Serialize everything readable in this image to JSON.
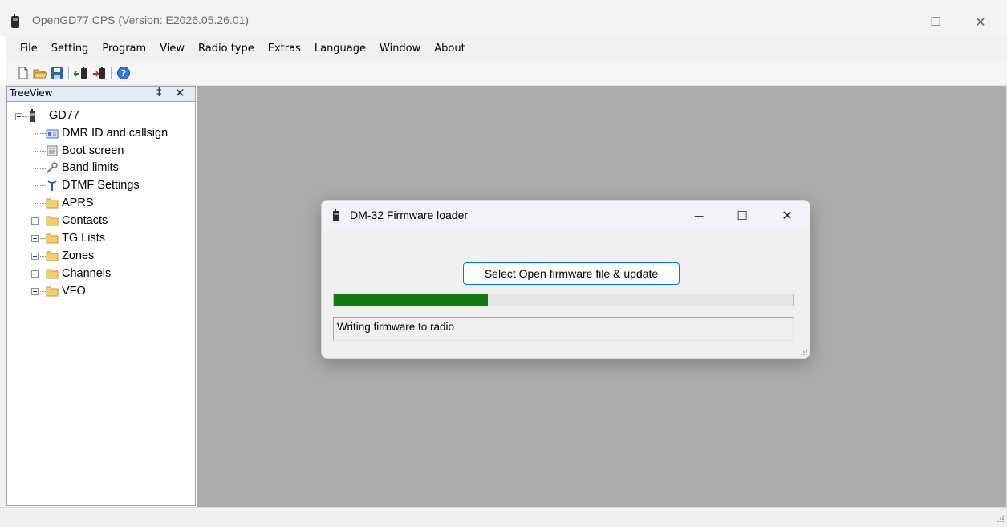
{
  "window": {
    "title": "OpenGD77 CPS (Version: E2026.05.26.01)",
    "minimize_glyph": "—",
    "maximize_glyph": "☐",
    "close_glyph": "✕"
  },
  "menu": {
    "items": [
      "File",
      "Setting",
      "Program",
      "View",
      "Radio type",
      "Extras",
      "Language",
      "Window",
      "About"
    ]
  },
  "toolbar": {
    "buttons": [
      "new-file-icon",
      "open-folder-icon",
      "save-icon",
      "read-from-radio-icon",
      "write-to-radio-icon",
      "help-icon"
    ]
  },
  "treeview": {
    "title": "TreeView",
    "pin_glyph": "‡",
    "close_glyph": "✕",
    "root": {
      "label": "GD77",
      "expanded": true
    },
    "items": [
      {
        "label": "DMR ID and callsign",
        "icon": "dmr-id-icon",
        "expandable": false
      },
      {
        "label": "Boot screen",
        "icon": "boot-screen-icon",
        "expandable": false
      },
      {
        "label": "Band limits",
        "icon": "wrench-icon",
        "expandable": false
      },
      {
        "label": "DTMF Settings",
        "icon": "antenna-icon",
        "expandable": false
      },
      {
        "label": "APRS",
        "icon": "folder-icon",
        "expandable": false
      },
      {
        "label": "Contacts",
        "icon": "folder-icon",
        "expandable": true
      },
      {
        "label": "TG Lists",
        "icon": "folder-icon",
        "expandable": true
      },
      {
        "label": "Zones",
        "icon": "folder-icon",
        "expandable": true
      },
      {
        "label": "Channels",
        "icon": "folder-icon",
        "expandable": true
      },
      {
        "label": "VFO",
        "icon": "folder-icon",
        "expandable": true
      }
    ]
  },
  "dialog": {
    "title": "DM-32 Firmware loader",
    "minimize_glyph": "—",
    "maximize_glyph": "☐",
    "close_glyph": "✕",
    "select_button_label": "Select Open firmware file & update",
    "progress": 0.335,
    "status_text": "Writing firmware to radio"
  },
  "colors": {
    "progress_fill": "#0f7a12",
    "mdi_background": "#ababab",
    "button_border": "#0078d4"
  }
}
